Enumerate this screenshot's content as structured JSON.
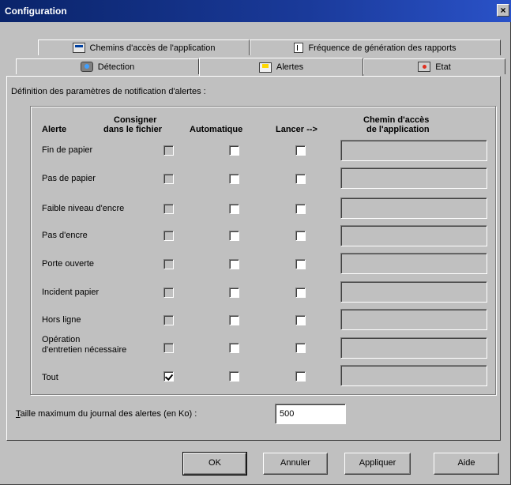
{
  "window": {
    "title": "Configuration",
    "close_glyph": "×"
  },
  "tabs_back": [
    {
      "label": "Chemins d'accès de l'application",
      "icon": "application-window-icon"
    },
    {
      "label": "Fréquence de génération des rapports",
      "icon": "document-icon"
    }
  ],
  "tabs_front": [
    {
      "label": "Détection",
      "icon": "printer-detection-icon"
    },
    {
      "label": "Alertes",
      "icon": "alert-printer-icon",
      "active": true
    },
    {
      "label": "Etat",
      "icon": "printer-status-icon"
    }
  ],
  "panel": {
    "description": "Définition des paramètres de notification d'alertes :",
    "headers": {
      "alerte": "Alerte",
      "consigner_line1": "Consigner",
      "consigner_line2": "dans le fichier",
      "automatique": "Automatique",
      "lancer": "Lancer -->",
      "chemin_line1": "Chemin d'accès",
      "chemin_line2": "de l'application"
    },
    "rows": [
      {
        "label": "Fin de papier",
        "consigner": false,
        "automatique": false,
        "lancer": false,
        "chemin": ""
      },
      {
        "label": "Pas de papier",
        "consigner": false,
        "automatique": false,
        "lancer": false,
        "chemin": ""
      },
      {
        "label": "Faible niveau d'encre",
        "consigner": false,
        "automatique": false,
        "lancer": false,
        "chemin": ""
      },
      {
        "label": "Pas d'encre",
        "consigner": false,
        "automatique": false,
        "lancer": false,
        "chemin": ""
      },
      {
        "label": "Porte ouverte",
        "consigner": false,
        "automatique": false,
        "lancer": false,
        "chemin": ""
      },
      {
        "label": "Incident papier",
        "consigner": false,
        "automatique": false,
        "lancer": false,
        "chemin": ""
      },
      {
        "label": "Hors ligne",
        "consigner": false,
        "automatique": false,
        "lancer": false,
        "chemin": ""
      },
      {
        "label_line1": "Opération",
        "label_line2": "d'entretien nécessaire",
        "consigner": false,
        "automatique": false,
        "lancer": false,
        "chemin": ""
      },
      {
        "label": "Tout",
        "consigner": true,
        "automatique": false,
        "lancer": false,
        "chemin": ""
      }
    ],
    "max_log": {
      "label_mnemonic": "T",
      "label_rest": "aille maximum du journal des alertes (en Ko) :",
      "value": "500"
    }
  },
  "buttons": {
    "ok": "OK",
    "cancel": "Annuler",
    "apply": "Appliquer",
    "help": "Aide"
  }
}
